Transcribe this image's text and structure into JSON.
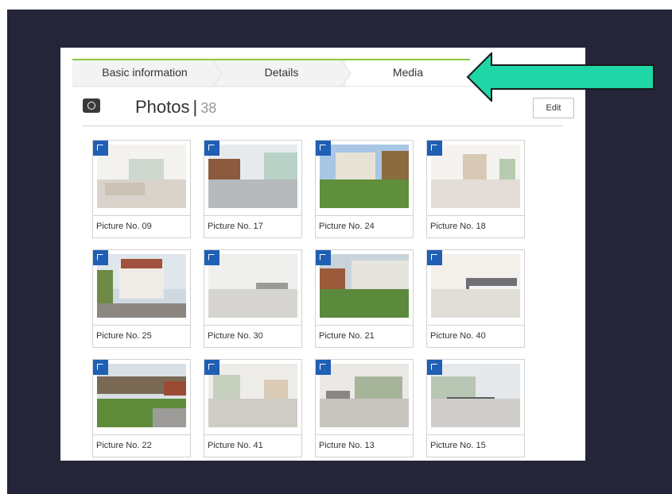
{
  "tabs": [
    {
      "label": "Basic information"
    },
    {
      "label": "Details"
    },
    {
      "label": "Media"
    }
  ],
  "photos": {
    "title": "Photos",
    "separator": "|",
    "count": "38",
    "edit_label": "Edit"
  },
  "pictures": [
    {
      "caption": "Picture No. 09",
      "scene": "living-room"
    },
    {
      "caption": "Picture No. 17",
      "scene": "kitchen"
    },
    {
      "caption": "Picture No. 24",
      "scene": "garden-house"
    },
    {
      "caption": "Picture No. 18",
      "scene": "hallway"
    },
    {
      "caption": "Picture No. 25",
      "scene": "house-front"
    },
    {
      "caption": "Picture No. 30",
      "scene": "bathroom"
    },
    {
      "caption": "Picture No. 21",
      "scene": "patio"
    },
    {
      "caption": "Picture No. 40",
      "scene": "bedroom"
    },
    {
      "caption": "Picture No. 22",
      "scene": "garden"
    },
    {
      "caption": "Picture No. 41",
      "scene": "bathroom-2"
    },
    {
      "caption": "Picture No. 13",
      "scene": "open-plan"
    },
    {
      "caption": "Picture No. 15",
      "scene": "kitchen-2"
    }
  ],
  "colors": {
    "tab_accent": "#8cc63f",
    "badge_blue": "#1f5fb4",
    "arrow_fill": "#1fd6a6",
    "backdrop": "#25253a"
  }
}
